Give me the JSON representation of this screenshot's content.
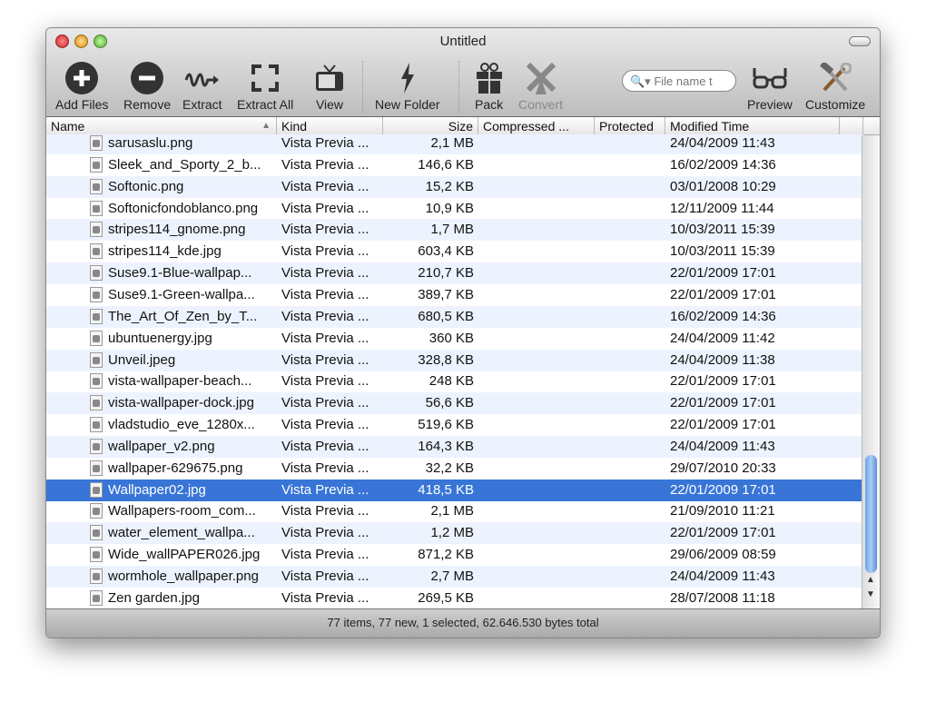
{
  "window": {
    "title": "Untitled"
  },
  "toolbar": {
    "add": "Add Files",
    "remove": "Remove",
    "extract": "Extract",
    "extract_all": "Extract All",
    "view": "View",
    "new_folder": "New Folder",
    "pack": "Pack",
    "convert": "Convert",
    "search_placeholder": "File name t",
    "preview": "Preview",
    "customize": "Customize"
  },
  "columns": [
    "Name",
    "Kind",
    "Size",
    "Compressed ...",
    "Protected",
    "Modified Time"
  ],
  "rows": [
    [
      "sarusaslu.png",
      "Vista Previa ...",
      "2,1 MB",
      "24/04/2009 11:43"
    ],
    [
      "Sleek_and_Sporty_2_b...",
      "Vista Previa ...",
      "146,6 KB",
      "16/02/2009 14:36"
    ],
    [
      "Softonic.png",
      "Vista Previa ...",
      "15,2 KB",
      "03/01/2008 10:29"
    ],
    [
      "Softonicfondoblanco.png",
      "Vista Previa ...",
      "10,9 KB",
      "12/11/2009 11:44"
    ],
    [
      "stripes114_gnome.png",
      "Vista Previa ...",
      "1,7 MB",
      "10/03/2011 15:39"
    ],
    [
      "stripes114_kde.jpg",
      "Vista Previa ...",
      "603,4 KB",
      "10/03/2011 15:39"
    ],
    [
      "Suse9.1-Blue-wallpap...",
      "Vista Previa ...",
      "210,7 KB",
      "22/01/2009 17:01"
    ],
    [
      "Suse9.1-Green-wallpa...",
      "Vista Previa ...",
      "389,7 KB",
      "22/01/2009 17:01"
    ],
    [
      "The_Art_Of_Zen_by_T...",
      "Vista Previa ...",
      "680,5 KB",
      "16/02/2009 14:36"
    ],
    [
      "ubuntuenergy.jpg",
      "Vista Previa ...",
      "360 KB",
      "24/04/2009 11:42"
    ],
    [
      "Unveil.jpeg",
      "Vista Previa ...",
      "328,8 KB",
      "24/04/2009 11:38"
    ],
    [
      "vista-wallpaper-beach...",
      "Vista Previa ...",
      "248 KB",
      "22/01/2009 17:01"
    ],
    [
      "vista-wallpaper-dock.jpg",
      "Vista Previa ...",
      "56,6 KB",
      "22/01/2009 17:01"
    ],
    [
      "vladstudio_eve_1280x...",
      "Vista Previa ...",
      "519,6 KB",
      "22/01/2009 17:01"
    ],
    [
      "wallpaper_v2.png",
      "Vista Previa ...",
      "164,3 KB",
      "24/04/2009 11:43"
    ],
    [
      "wallpaper-629675.png",
      "Vista Previa ...",
      "32,2 KB",
      "29/07/2010 20:33"
    ],
    [
      "Wallpaper02.jpg",
      "Vista Previa ...",
      "418,5 KB",
      "22/01/2009 17:01"
    ],
    [
      "Wallpapers-room_com...",
      "Vista Previa ...",
      "2,1 MB",
      "21/09/2010 11:21"
    ],
    [
      "water_element_wallpa...",
      "Vista Previa ...",
      "1,2 MB",
      "22/01/2009 17:01"
    ],
    [
      "Wide_wallPAPER026.jpg",
      "Vista Previa ...",
      "871,2 KB",
      "29/06/2009 08:59"
    ],
    [
      "wormhole_wallpaper.png",
      "Vista Previa ...",
      "2,7 MB",
      "24/04/2009 11:43"
    ],
    [
      "Zen garden.jpg",
      "Vista Previa ...",
      "269,5 KB",
      "28/07/2008 11:18"
    ]
  ],
  "selected_index": 16,
  "status": "77 items, 77 new, 1 selected, 62.646.530 bytes total",
  "colors": {
    "selection": "#3875d7",
    "alt_row": "#edf3fe"
  }
}
